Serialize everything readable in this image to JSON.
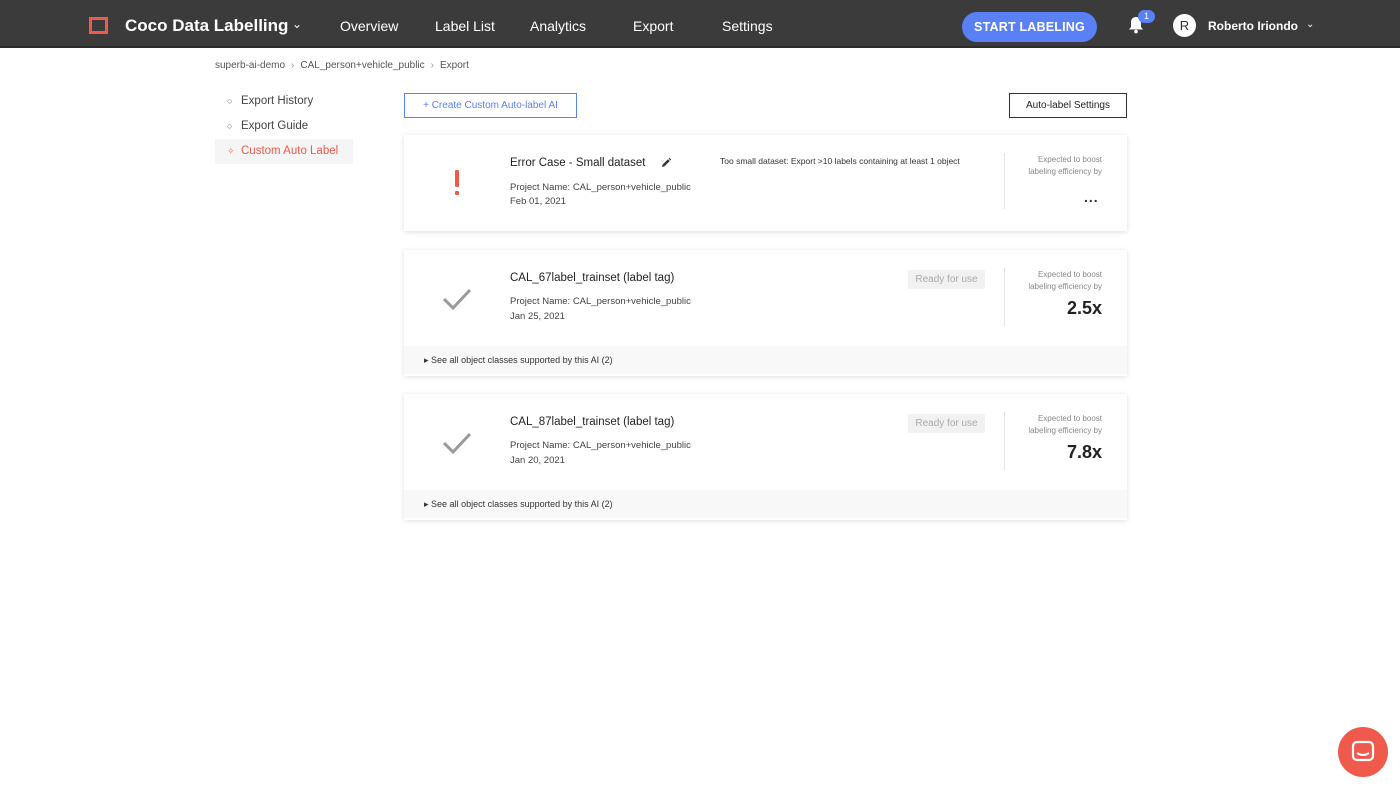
{
  "app": {
    "title": "Coco Data Labelling"
  },
  "nav": {
    "items": [
      {
        "label": "Overview"
      },
      {
        "label": "Label List"
      },
      {
        "label": "Analytics"
      },
      {
        "label": "Export"
      },
      {
        "label": "Settings"
      }
    ],
    "start_button": "START LABELING",
    "notification_count": "1",
    "user": {
      "initial": "R",
      "name": "Roberto Iriondo"
    }
  },
  "breadcrumb": [
    "superb-ai-demo",
    "CAL_person+vehicle_public",
    "Export"
  ],
  "sidebar": {
    "items": [
      {
        "label": "Export History",
        "icon": "history-icon"
      },
      {
        "label": "Export Guide",
        "icon": "guide-icon"
      },
      {
        "label": "Custom Auto Label",
        "icon": "auto-label-icon",
        "active": true
      }
    ]
  },
  "actions": {
    "create_label": "+ Create Custom Auto-label AI",
    "settings_label": "Auto-label Settings"
  },
  "cards": [
    {
      "status": "error",
      "title": "Error Case - Small dataset",
      "project": "Project Name: CAL_person+vehicle_public",
      "date": "Feb 01, 2021",
      "error_note": "Too small dataset: Export >10 labels containing at least 1 object",
      "boost_label": "Expected to boost labeling efficiency by",
      "boost_value": "..."
    },
    {
      "status": "ready",
      "title": "CAL_67label_trainset (label tag)",
      "project": "Project Name: CAL_person+vehicle_public",
      "date": "Jan 25, 2021",
      "ready_label": "Ready for use",
      "boost_label": "Expected to boost labeling efficiency by",
      "boost_value": "2.5x",
      "footer": "See all object classes supported by this AI (2)"
    },
    {
      "status": "ready",
      "title": "CAL_87label_trainset (label tag)",
      "project": "Project Name: CAL_person+vehicle_public",
      "date": "Jan 20, 2021",
      "ready_label": "Ready for use",
      "boost_label": "Expected to boost labeling efficiency by",
      "boost_value": "7.8x",
      "footer": "See all object classes supported by this AI (2)"
    }
  ],
  "colors": {
    "accent": "#5a80f5",
    "brand": "#ef5a4c",
    "topbar": "#3b3b3b"
  }
}
